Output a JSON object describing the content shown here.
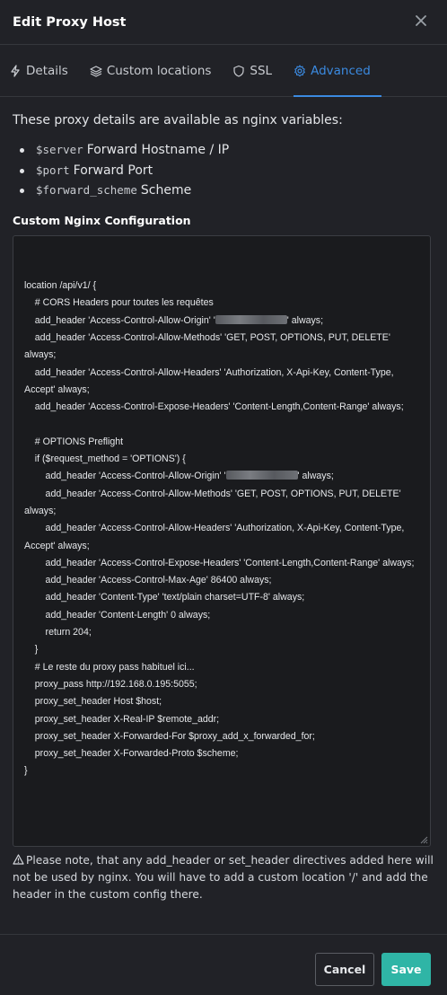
{
  "dialog": {
    "title": "Edit Proxy Host"
  },
  "tabs": [
    {
      "label": "Details",
      "icon": "bolt-icon"
    },
    {
      "label": "Custom locations",
      "icon": "layers-icon"
    },
    {
      "label": "SSL",
      "icon": "shield-icon"
    },
    {
      "label": "Advanced",
      "icon": "gear-icon",
      "active": true
    }
  ],
  "advanced": {
    "intro": "These proxy details are available as nginx variables:",
    "variables": [
      {
        "name": "$server",
        "desc": "Forward Hostname / IP"
      },
      {
        "name": "$port",
        "desc": "Forward Port"
      },
      {
        "name": "$forward_scheme",
        "desc": "Scheme"
      }
    ],
    "config_label": "Custom Nginx Configuration",
    "config_lines": [
      "location /api/v1/ {",
      "    # CORS Headers pour toutes les requêtes",
      "    add_header 'Access-Control-Allow-Origin' '[redacted]' always;",
      "    add_header 'Access-Control-Allow-Methods' 'GET, POST, OPTIONS, PUT, DELETE' always;",
      "    add_header 'Access-Control-Allow-Headers' 'Authorization, X-Api-Key, Content-Type, Accept' always;",
      "    add_header 'Access-Control-Expose-Headers' 'Content-Length,Content-Range' always;",
      "",
      "    # OPTIONS Preflight",
      "    if ($request_method = 'OPTIONS') {",
      "        add_header 'Access-Control-Allow-Origin' '[redacted]' always;",
      "        add_header 'Access-Control-Allow-Methods' 'GET, POST, OPTIONS, PUT, DELETE' always;",
      "        add_header 'Access-Control-Allow-Headers' 'Authorization, X-Api-Key, Content-Type, Accept' always;",
      "        add_header 'Access-Control-Expose-Headers' 'Content-Length,Content-Range' always;",
      "        add_header 'Access-Control-Max-Age' 86400 always;",
      "        add_header 'Content-Type' 'text/plain charset=UTF-8' always;",
      "        add_header 'Content-Length' 0 always;",
      "        return 204;",
      "    }",
      "    # Le reste du proxy pass habituel ici...",
      "    proxy_pass http://192.168.0.195:5055;",
      "    proxy_set_header Host $host;",
      "    proxy_set_header X-Real-IP $remote_addr;",
      "    proxy_set_header X-Forwarded-For $proxy_add_x_forwarded_for;",
      "    proxy_set_header X-Forwarded-Proto $scheme;",
      "}"
    ],
    "note": "Please note, that any add_header or set_header directives added here will not be used by nginx. You will have to add a custom location '/' and add the header in the custom config there."
  },
  "footer": {
    "cancel_label": "Cancel",
    "save_label": "Save"
  },
  "colors": {
    "accent": "#3b8ae0",
    "save": "#2fb5a6",
    "background": "#212227"
  }
}
